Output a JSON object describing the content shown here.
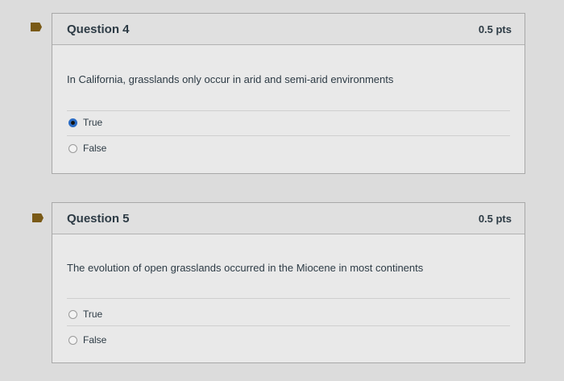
{
  "questions": [
    {
      "title": "Question 4",
      "points": "0.5 pts",
      "text": "In California, grasslands only occur in arid and semi-arid environments",
      "answers": [
        {
          "label": "True",
          "selected": true
        },
        {
          "label": "False",
          "selected": false
        }
      ]
    },
    {
      "title": "Question 5",
      "points": "0.5 pts",
      "text": "The evolution of open grasslands occurred in the Miocene in most continents",
      "answers": [
        {
          "label": "True",
          "selected": false
        },
        {
          "label": "False",
          "selected": false
        }
      ]
    }
  ]
}
